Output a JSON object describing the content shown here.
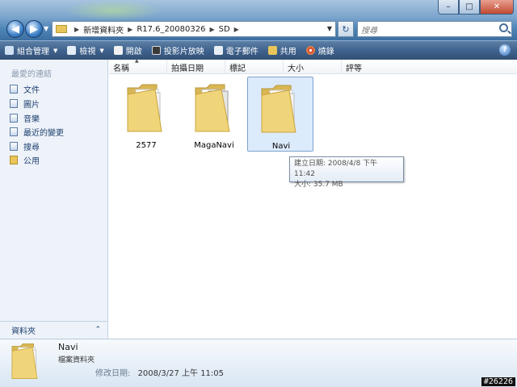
{
  "window": {
    "buttons": {
      "minimize": "–",
      "maximize": "□",
      "close": "✕"
    }
  },
  "nav": {
    "back_glyph": "◀",
    "forward_glyph": "▶",
    "history_glyph": "▼"
  },
  "address": {
    "breadcrumbs": [
      "新增資料夾",
      "R17.6_20080326",
      "SD"
    ],
    "refresh_glyph": "↻"
  },
  "search": {
    "placeholder": "搜尋"
  },
  "commands": [
    {
      "label": "組合管理",
      "dropdown": true,
      "icon": "organize-icon"
    },
    {
      "label": "檢視",
      "dropdown": true,
      "icon": "views-icon"
    },
    {
      "label": "開啟",
      "dropdown": false,
      "icon": "open-icon"
    },
    {
      "label": "投影片放映",
      "dropdown": false,
      "icon": "slideshow-icon"
    },
    {
      "label": "電子郵件",
      "dropdown": false,
      "icon": "email-icon"
    },
    {
      "label": "共用",
      "dropdown": false,
      "icon": "share-icon"
    },
    {
      "label": "燒錄",
      "dropdown": false,
      "icon": "burn-icon"
    }
  ],
  "help_glyph": "?",
  "sidebar": {
    "heading": "最愛的連結",
    "items": [
      {
        "label": "文件",
        "icon": "documents-icon"
      },
      {
        "label": "圖片",
        "icon": "pictures-icon"
      },
      {
        "label": "音樂",
        "icon": "music-icon"
      },
      {
        "label": "最近的變更",
        "icon": "recent-changes-icon"
      },
      {
        "label": "搜尋",
        "icon": "searches-icon"
      },
      {
        "label": "公用",
        "icon": "public-folder-icon"
      }
    ],
    "folders_label": "資料夾",
    "folders_toggle": "⌃"
  },
  "columns": [
    "名稱",
    "拍攝日期",
    "標記",
    "大小",
    "評等"
  ],
  "files": [
    {
      "name": "2577",
      "type": "folder",
      "selected": false
    },
    {
      "name": "MagaNavi",
      "type": "folder",
      "selected": false
    },
    {
      "name": "Navi",
      "type": "folder",
      "selected": true
    }
  ],
  "tooltip": {
    "created": "建立日期: 2008/4/8 下午 11:42",
    "size": "大小: 35.7 MB"
  },
  "details": {
    "name": "Navi",
    "type": "檔案資料夾",
    "modified_key": "修改日期:",
    "modified_value": "2008/3/27 上午 11:05"
  },
  "watermark": "#26226",
  "colors": {
    "selection_fill": "#dcebfc",
    "selection_border": "#7da2ce",
    "folder_yellow": "#efd175",
    "command_bar": "#3f638e"
  }
}
